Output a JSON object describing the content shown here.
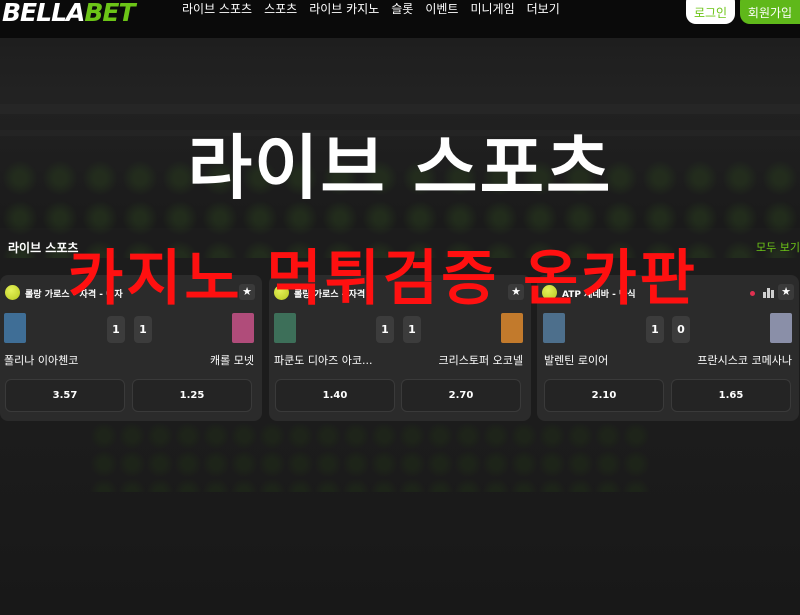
{
  "logo": {
    "prefix": "BELLA",
    "suffix": "BET"
  },
  "nav": [
    "라이브 스포츠",
    "스포츠",
    "라이브 카지노",
    "슬롯",
    "이벤트",
    "미니게임",
    "더보기"
  ],
  "auth": {
    "login": "로그인",
    "join": "회원가입"
  },
  "hero": {
    "title": "라이브 스포츠"
  },
  "section": {
    "title": "라이브 스포츠",
    "see_all": "모두 보기"
  },
  "watermark": "카지노 먹튀검증 온카판",
  "colors": {
    "brand_green": "#6cc417",
    "live_red": "#e03050",
    "watermark_red": "#ff1010"
  },
  "matches": [
    {
      "league": "롤랑 가로스 - 자격 - 여자",
      "home": {
        "name": "폴리나 이아첸코",
        "score": "1",
        "avatar_color": "#3f6e96"
      },
      "away": {
        "name": "캐롤 모넷",
        "score": "1",
        "avatar_color": "#b04c7a"
      },
      "odds": [
        "3.57",
        "1.25"
      ]
    },
    {
      "league": "롤랑 가로스 - 자격",
      "home": {
        "name": "파쿤도 디아즈 아코...",
        "score": "1",
        "avatar_color": "#3d6f59"
      },
      "away": {
        "name": "크리스토퍼 오코넬",
        "score": "1",
        "avatar_color": "#c27a2c"
      },
      "odds": [
        "1.40",
        "2.70"
      ]
    },
    {
      "league": "ATP 제네바 - 단식",
      "home": {
        "name": "발렌틴 로이어",
        "score": "1",
        "avatar_color": "#4d6f8c"
      },
      "away": {
        "name": "프란시스코 코메사나",
        "score": "0",
        "avatar_color": "#8a8fa8"
      },
      "odds": [
        "2.10",
        "1.65"
      ]
    }
  ]
}
